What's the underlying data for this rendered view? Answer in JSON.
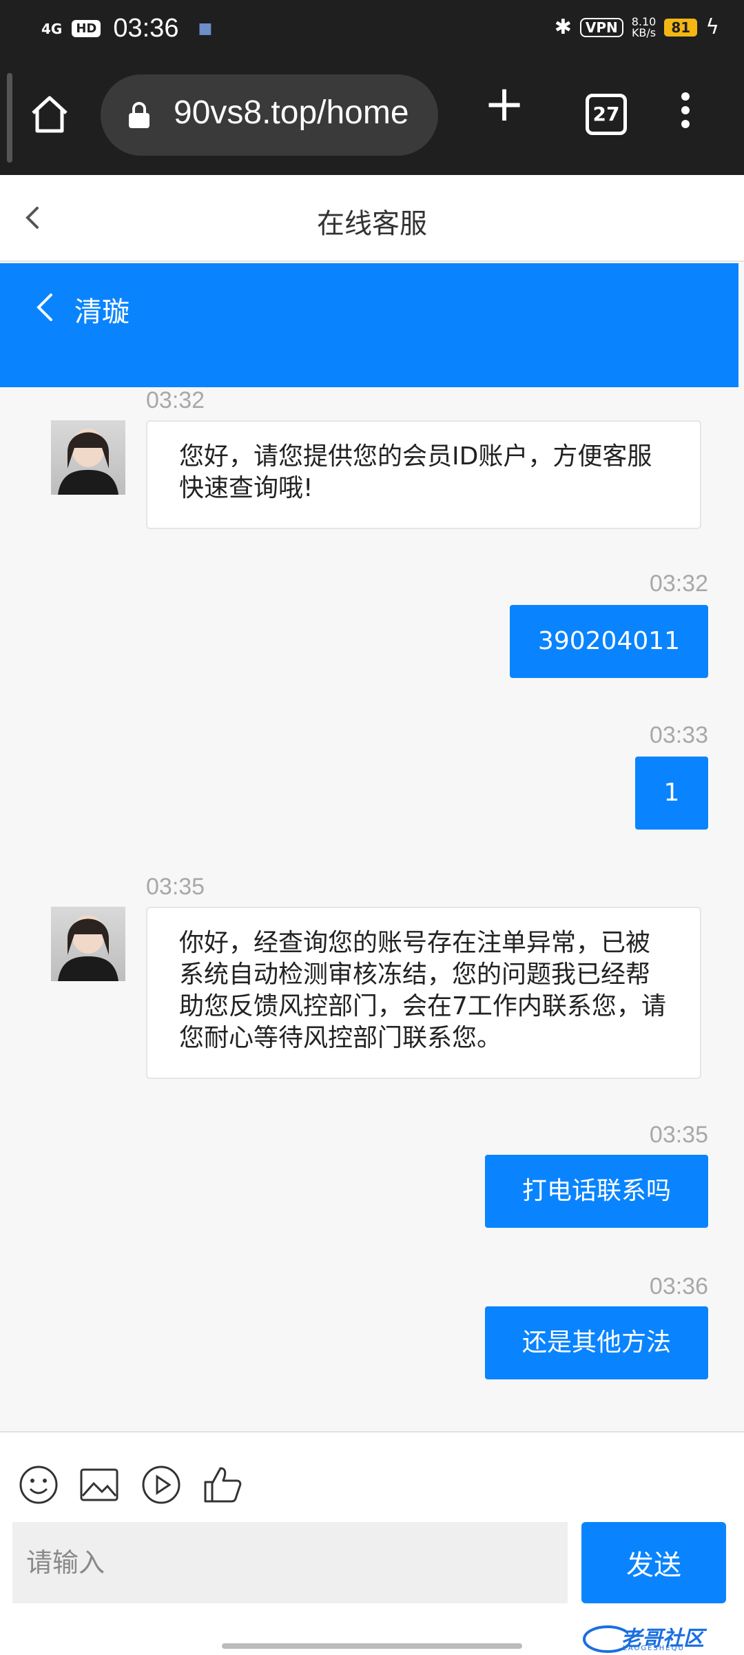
{
  "status_bar": {
    "network": "4G",
    "hd": "HD",
    "time": "03:36",
    "bluetooth_icon": "bluetooth-icon",
    "vpn": "VPN",
    "speed_value": "8.10",
    "speed_unit": "KB/s",
    "battery": "81",
    "charging_icon": "bolt-icon"
  },
  "browser": {
    "url": "90vs8.top/home",
    "tab_count": "27",
    "home_icon": "home-icon",
    "lock_icon": "lock-icon",
    "new_tab_icon": "plus-icon",
    "menu_icon": "more-vertical-icon"
  },
  "page": {
    "title": "在线客服"
  },
  "chat": {
    "agent_name": "清璇",
    "accent_color": "#0a84fe",
    "messages": [
      {
        "side": "in",
        "time": "03:32",
        "text": "您好，请您提供您的会员ID账户，方便客服快速查询哦!"
      },
      {
        "side": "out",
        "time": "03:32",
        "text": "390204011"
      },
      {
        "side": "out",
        "time": "03:33",
        "text": "1"
      },
      {
        "side": "in",
        "time": "03:35",
        "text": "你好，经查询您的账号存在注单异常，已被系统自动检测审核冻结，您的问题我已经帮助您反馈风控部门，会在7工作内联系您，请您耐心等待风控部门联系您。"
      },
      {
        "side": "out",
        "time": "03:35",
        "text": "打电话联系吗"
      },
      {
        "side": "out",
        "time": "03:36",
        "text": "还是其他方法"
      }
    ]
  },
  "composer": {
    "placeholder": "请输入",
    "send_label": "发送",
    "tools": [
      "emoji-icon",
      "image-icon",
      "video-icon",
      "thumbs-up-icon"
    ]
  },
  "watermark": {
    "text": "老哥社区",
    "sub": "LAOGESHEQU"
  }
}
